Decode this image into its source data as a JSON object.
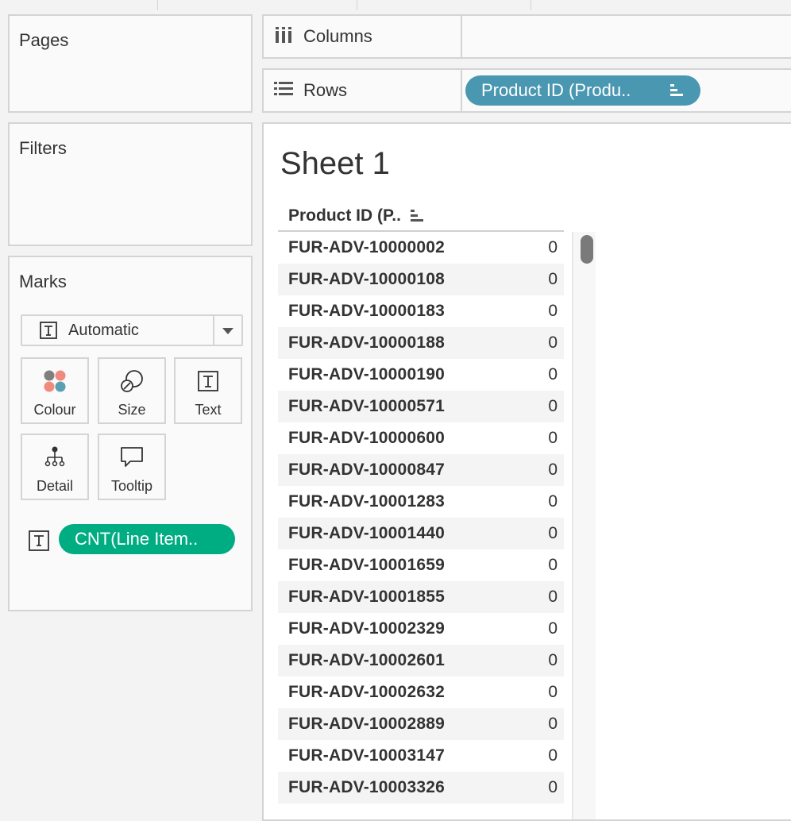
{
  "shelves": {
    "pages": {
      "title": "Pages"
    },
    "filters": {
      "title": "Filters"
    },
    "columns": {
      "label": "Columns",
      "icon": "columns-icon"
    },
    "rows": {
      "label": "Rows",
      "icon": "rows-icon",
      "pill": {
        "label": "Product ID (Produ..",
        "color": "#4a97b1",
        "sort_icon": "sort-descending-icon"
      }
    }
  },
  "marks": {
    "title": "Marks",
    "mark_type": {
      "label": "Automatic",
      "icon": "text-mark-icon"
    },
    "cards": [
      {
        "label": "Colour",
        "icon": "colour-dots-icon"
      },
      {
        "label": "Size",
        "icon": "size-icon"
      },
      {
        "label": "Text",
        "icon": "text-icon"
      },
      {
        "label": "Detail",
        "icon": "detail-hierarchy-icon"
      },
      {
        "label": "Tooltip",
        "icon": "tooltip-speech-icon"
      }
    ],
    "fields": [
      {
        "encoding": "text",
        "label": "CNT(Line Item..",
        "color": "#00ad82"
      }
    ],
    "colour_dots": [
      "#7f7f7f",
      "#f08a7c",
      "#f08a7c",
      "#5aa0b0"
    ]
  },
  "view": {
    "sheet_title": "Sheet 1",
    "column_header": "Product ID (P..",
    "rows": [
      {
        "product_id": "FUR-ADV-10000002",
        "count": "0"
      },
      {
        "product_id": "FUR-ADV-10000108",
        "count": "0"
      },
      {
        "product_id": "FUR-ADV-10000183",
        "count": "0"
      },
      {
        "product_id": "FUR-ADV-10000188",
        "count": "0"
      },
      {
        "product_id": "FUR-ADV-10000190",
        "count": "0"
      },
      {
        "product_id": "FUR-ADV-10000571",
        "count": "0"
      },
      {
        "product_id": "FUR-ADV-10000600",
        "count": "0"
      },
      {
        "product_id": "FUR-ADV-10000847",
        "count": "0"
      },
      {
        "product_id": "FUR-ADV-10001283",
        "count": "0"
      },
      {
        "product_id": "FUR-ADV-10001440",
        "count": "0"
      },
      {
        "product_id": "FUR-ADV-10001659",
        "count": "0"
      },
      {
        "product_id": "FUR-ADV-10001855",
        "count": "0"
      },
      {
        "product_id": "FUR-ADV-10002329",
        "count": "0"
      },
      {
        "product_id": "FUR-ADV-10002601",
        "count": "0"
      },
      {
        "product_id": "FUR-ADV-10002632",
        "count": "0"
      },
      {
        "product_id": "FUR-ADV-10002889",
        "count": "0"
      },
      {
        "product_id": "FUR-ADV-10003147",
        "count": "0"
      },
      {
        "product_id": "FUR-ADV-10003326",
        "count": "0"
      }
    ]
  }
}
